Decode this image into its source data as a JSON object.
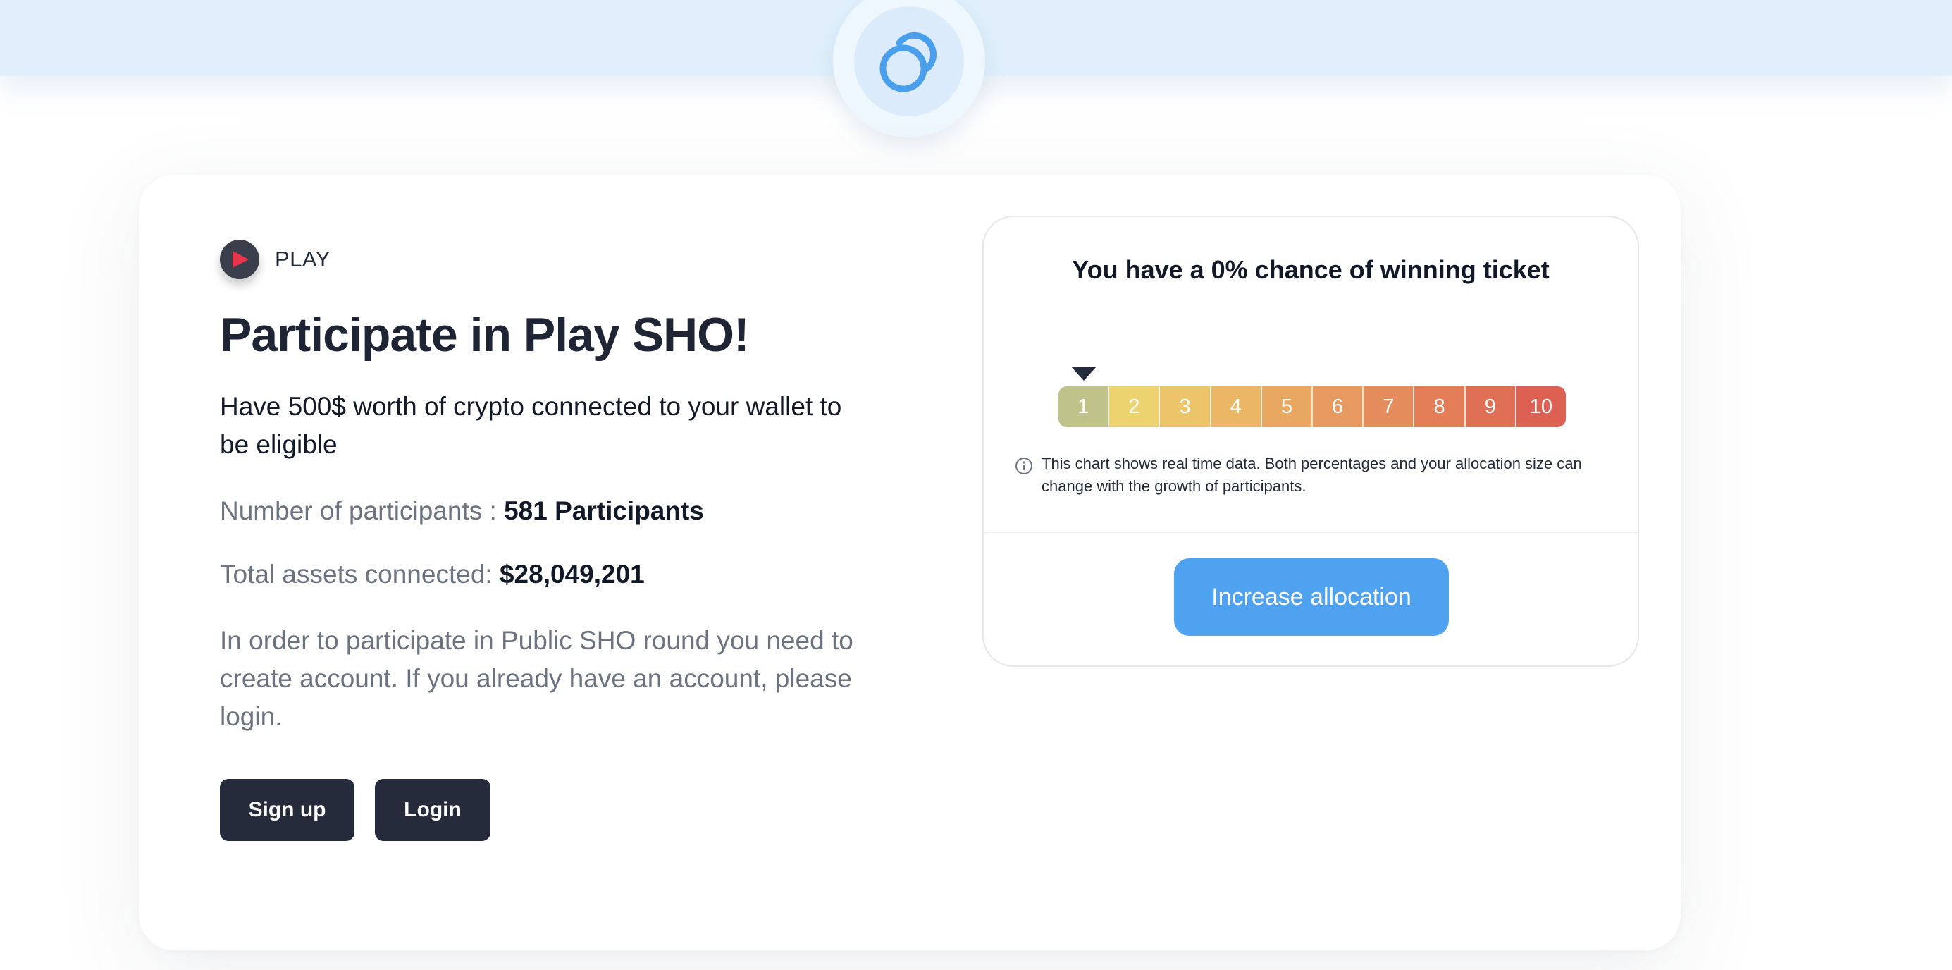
{
  "header": {
    "logo_icon": "linked-rings-icon"
  },
  "project": {
    "token_icon": "play-icon",
    "token_name": "PLAY",
    "title": "Participate in Play SHO!",
    "eligibility": "Have 500$ worth of crypto connected to your wallet to be eligible",
    "participants_label": "Number of participants :",
    "participants_value": "581 Participants",
    "assets_label": "Total assets connected:",
    "assets_value": "$28,049,201",
    "notice": "In order to participate in Public SHO round you need to create account. If you already have an account, please login.",
    "signup_label": "Sign up",
    "login_label": "Login"
  },
  "chance_panel": {
    "title": "You have a 0% chance of winning ticket",
    "scale_labels": [
      "1",
      "2",
      "3",
      "4",
      "5",
      "6",
      "7",
      "8",
      "9",
      "10"
    ],
    "current_level": 1,
    "info_icon": "info-icon",
    "info_text": "This chart shows real time data. Both percentages and your allocation size can change with the growth of participants.",
    "increase_label": "Increase allocation"
  },
  "colors": {
    "band": "#e0effb",
    "accent": "#4fa2f0",
    "dark_button": "#262b3c",
    "scale": [
      "#bfc38a",
      "#ecd36f",
      "#ecc56a",
      "#ebb666",
      "#e9a862",
      "#e79a5f",
      "#e58c5c",
      "#e37e59",
      "#e07055",
      "#dc6152"
    ]
  }
}
